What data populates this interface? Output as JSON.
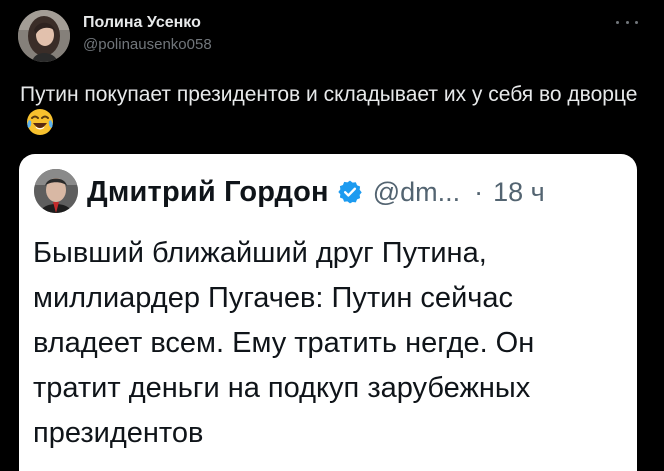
{
  "tweet": {
    "author_name": "Полина Усенко",
    "author_handle": "@polinausenko058",
    "text": "Путин покупает президентов и складывает их у себя во дворце",
    "emoji": "face-with-tears-of-joy-icon",
    "more_icon": "more-horizontal-icon"
  },
  "quote": {
    "author_name": "Дмитрий Гордон",
    "verified_icon": "verified-badge-icon",
    "author_handle": "@dm...",
    "separator": "·",
    "time": "18 ч",
    "text": "Бывший ближайший друг Путина, миллиардер Пугачев: Путин сейчас владеет всем. Ему тратить негде. Он тратит деньги на подкуп зарубежных президентов"
  },
  "colors": {
    "background": "#000000",
    "text_primary": "#e7e9ea",
    "text_secondary": "#71767b",
    "quote_background": "#ffffff",
    "quote_text": "#0f1419",
    "quote_secondary": "#536471",
    "verified": "#1d9bf0"
  }
}
